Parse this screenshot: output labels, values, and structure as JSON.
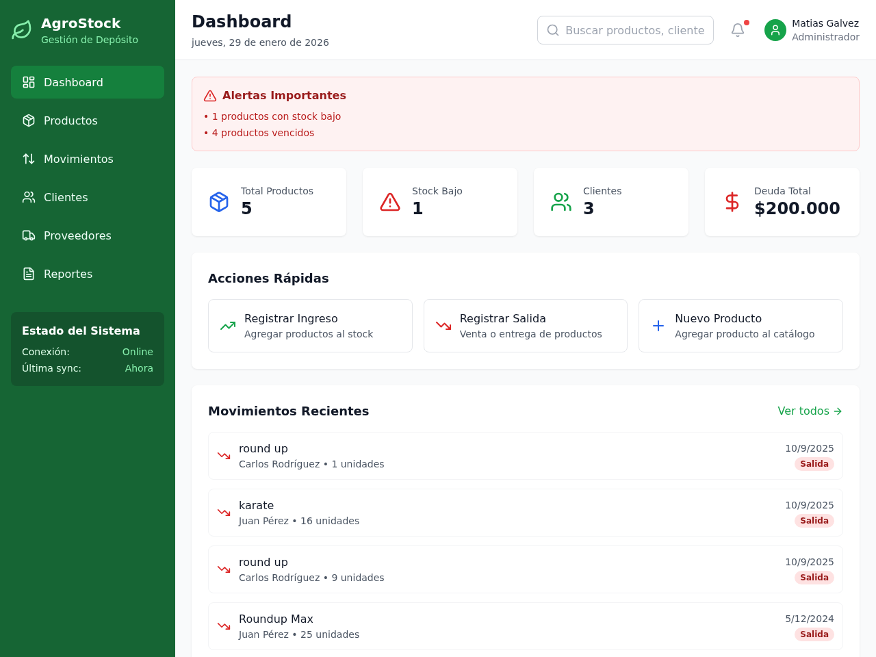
{
  "sidebar": {
    "brand": {
      "name": "AgroStock",
      "subtitle": "Gestión de Depósito"
    },
    "nav": [
      {
        "label": "Dashboard",
        "selected": true
      },
      {
        "label": "Productos",
        "selected": false
      },
      {
        "label": "Movimientos",
        "selected": false
      },
      {
        "label": "Clientes",
        "selected": false
      },
      {
        "label": "Proveedores",
        "selected": false
      },
      {
        "label": "Reportes",
        "selected": false
      }
    ],
    "status": {
      "title": "Estado del Sistema",
      "rows": [
        {
          "label": "Conexión:",
          "value": "Online"
        },
        {
          "label": "Última sync:",
          "value": "Ahora"
        }
      ]
    }
  },
  "header": {
    "title": "Dashboard",
    "date": "jueves, 29 de enero de 2026",
    "search": {
      "placeholder": "Buscar productos, cliente"
    },
    "notifications": {
      "unread": true
    },
    "user": {
      "name": "Matias Galvez",
      "role": "Administrador"
    }
  },
  "alert": {
    "title": "Alertas Importantes",
    "items": [
      "• 1 productos con stock bajo",
      "• 4 productos vencidos"
    ]
  },
  "stats": [
    {
      "label": "Total Productos",
      "value": "5",
      "color": "#2563eb"
    },
    {
      "label": "Stock Bajo",
      "value": "1",
      "color": "#dc2626"
    },
    {
      "label": "Clientes",
      "value": "3",
      "color": "#16a34a"
    },
    {
      "label": "Deuda Total",
      "value": "$200.000",
      "color": "#dc2626"
    }
  ],
  "quick_actions": {
    "title": "Acciones Rápidas",
    "items": [
      {
        "kind": "in",
        "title": "Registrar Ingreso",
        "subtitle": "Agregar productos al stock"
      },
      {
        "kind": "out",
        "title": "Registrar Salida",
        "subtitle": "Venta o entrega de productos"
      },
      {
        "kind": "new",
        "title": "Nuevo Producto",
        "subtitle": "Agregar producto al catálogo"
      }
    ]
  },
  "recent_movements": {
    "title": "Movimientos Recientes",
    "link": "Ver todos",
    "items": [
      {
        "kind": "out",
        "product": "round up",
        "detail": "Carlos Rodríguez • 1 unidades",
        "date": "10/9/2025",
        "badge": "Salida"
      },
      {
        "kind": "out",
        "product": "karate",
        "detail": "Juan Pérez • 16 unidades",
        "date": "10/9/2025",
        "badge": "Salida"
      },
      {
        "kind": "out",
        "product": "round up",
        "detail": "Carlos Rodríguez • 9 unidades",
        "date": "10/9/2025",
        "badge": "Salida"
      },
      {
        "kind": "out",
        "product": "Roundup Max",
        "detail": "Juan Pérez • 25 unidades",
        "date": "5/12/2024",
        "badge": "Salida"
      }
    ]
  }
}
